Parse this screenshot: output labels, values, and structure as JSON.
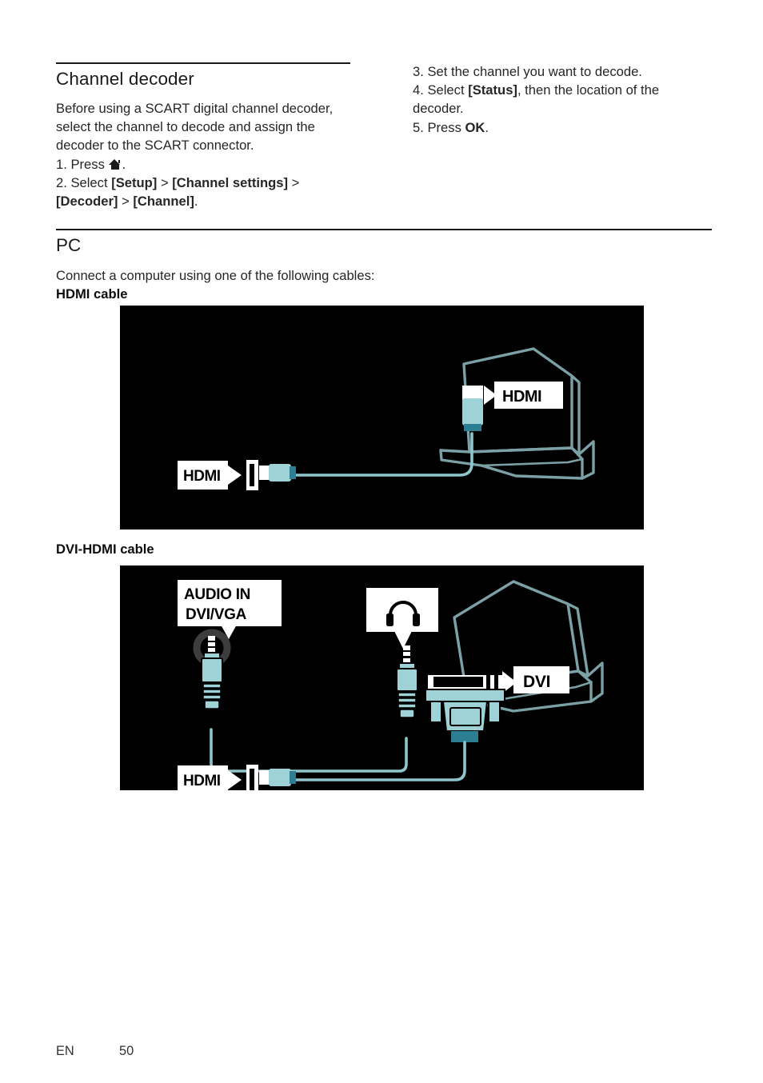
{
  "document": {
    "language_code": "EN",
    "page_number": "50"
  },
  "channel_decoder": {
    "title": "Channel decoder",
    "intro": "Before using a SCART digital channel decoder, select the channel to decode and assign the decoder to the SCART connector.",
    "steps": {
      "step1_prefix": "1. Press ",
      "step1_icon": "home-icon",
      "step1_suffix": ".",
      "step2_prefix": "2. Select ",
      "step2_setup": "[Setup]",
      "step2_sep1": " > ",
      "step2_channel_settings": "[Channel settings]",
      "step2_sep2": " > ",
      "step2_decoder": "[Decoder]",
      "step2_sep3": " > ",
      "step2_channel": "[Channel]",
      "step2_suffix": ".",
      "step3": "3. Set the channel you want to decode.",
      "step4_prefix": "4. Select ",
      "step4_status": "[Status]",
      "step4_suffix": ", then the location of the decoder.",
      "step5_prefix": "5. Press ",
      "step5_ok": "OK",
      "step5_suffix": "."
    }
  },
  "pc": {
    "title": "PC",
    "intro": "Connect a computer using one of the following cables:",
    "figures": [
      {
        "caption": "HDMI cable",
        "name": "hdmi-cable-diagram",
        "background": "#000000",
        "callouts": [
          "HDMI",
          "HDMI"
        ],
        "device": "laptop",
        "cable_color": "#9fd2d6",
        "cable_accent": "#2c7f92",
        "outline_color": "#7ba0a6"
      },
      {
        "caption_bold": "DVI-HDMI",
        "caption_rest": " cable",
        "caption": "DVI-HDMI cable",
        "name": "dvi-hdmi-cable-diagram",
        "background": "#000000",
        "callouts": [
          "AUDIO IN DVI/VGA",
          "headphone-icon",
          "DVI",
          "HDMI"
        ],
        "callout_audio_line1": "AUDIO IN",
        "callout_audio_line2": "DVI/VGA",
        "callout_dvi": "DVI",
        "callout_hdmi": "HDMI",
        "device": "laptop",
        "cable_color": "#9fd2d6",
        "cable_accent": "#2c7f92",
        "outline_color": "#7ba0a6"
      }
    ]
  },
  "colors": {
    "page_background": "#ffffff",
    "text": "#262626",
    "heading": "#1a1a1a",
    "figure_background": "#000000",
    "cable_light": "#9fd2d6",
    "cable_mid": "#8ec6cc",
    "cable_dark": "#2c7f92",
    "device_outline": "#7ba0a6",
    "callout_background": "#ffffff",
    "callout_text": "#000000"
  }
}
